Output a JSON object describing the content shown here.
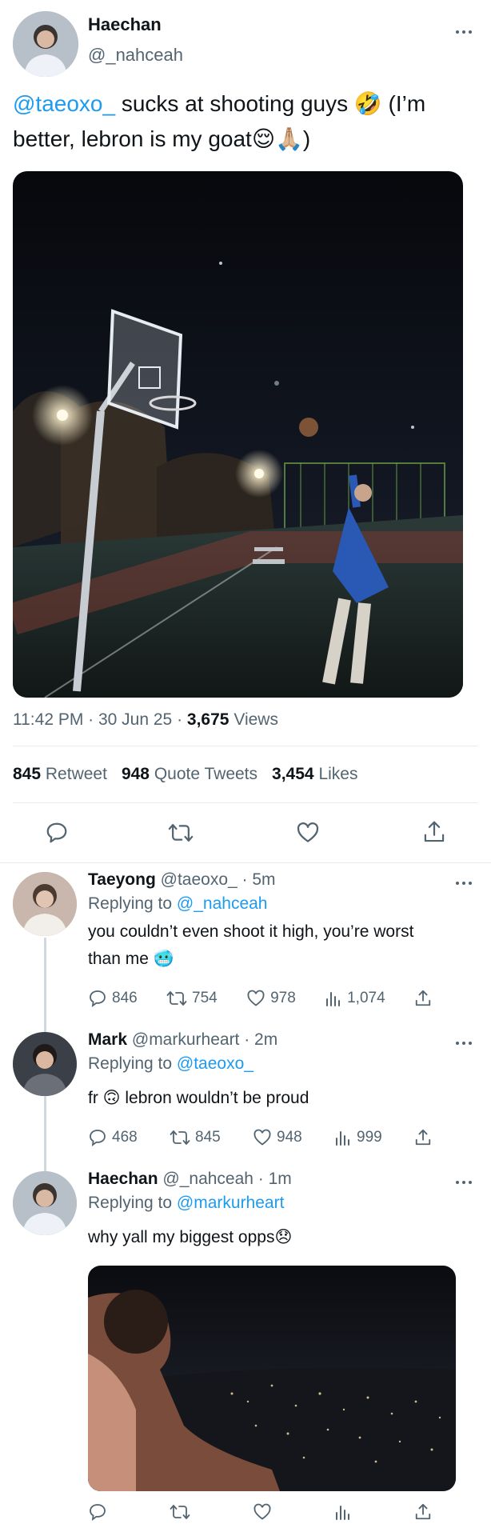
{
  "main_tweet": {
    "author_name": "Haechan",
    "author_handle": "@_nahceah",
    "text_mention": "@taeoxo_",
    "text_line1": "sucks at shooting guys 🤣 (I’m",
    "text_line2": "better, lebron is my goat😌🙏🏼)",
    "time": "11:42 PM · 30 Jun 25 ·",
    "views_count": "3,675",
    "views_label": "Views",
    "retweets_count": "845",
    "retweets_label": "Retweet",
    "quotes_count": "948",
    "quotes_label": "Quote Tweets",
    "likes_count": "3,454",
    "likes_label": "Likes"
  },
  "replies": [
    {
      "author_name": "Taeyong",
      "meta": "@taeoxo_ · 5m",
      "replying_label": "Replying to",
      "replying_to": "@_nahceah",
      "text_line1": "you couldn’t even shoot it high, you’re worst",
      "text_line2": "than me 🥶",
      "replies": "846",
      "retweets": "754",
      "likes": "978",
      "views": "1,074"
    },
    {
      "author_name": "Mark",
      "meta": "@markurheart · 2m",
      "replying_label": "Replying to",
      "replying_to": "@taeoxo_",
      "text_line1": "fr 🙃  lebron wouldn’t be proud",
      "replies": "468",
      "retweets": "845",
      "likes": "948",
      "views": "999"
    },
    {
      "author_name": "Haechan",
      "meta": "@_nahceah · 1m",
      "replying_label": "Replying to",
      "replying_to": "@markurheart",
      "text_line1": "why yall my biggest opps😞"
    }
  ],
  "icons": {
    "reply": "reply-icon",
    "retweet": "retweet-icon",
    "like": "heart-icon",
    "views": "views-icon",
    "share": "share-icon",
    "more": "more-icon"
  },
  "colors": {
    "link": "#1d9bf0",
    "muted": "#536471",
    "text": "#0f1419",
    "divider": "#e6ecf0"
  }
}
